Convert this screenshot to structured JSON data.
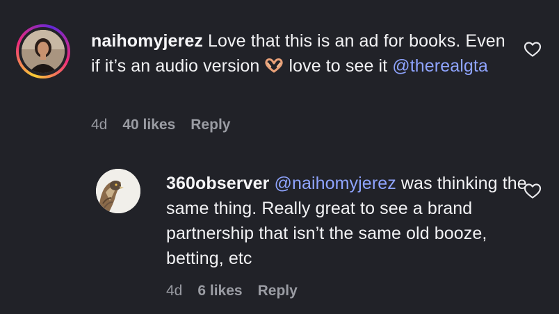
{
  "comments": [
    {
      "username": "naihomyjerez",
      "text_before_emoji": "Love that this is an ad for books. Even if it’s an audio version",
      "emoji_icon": "heart-hands-emoji",
      "text_after_emoji": "love to see it",
      "mention": "@therealgta",
      "time": "4d",
      "likes": "40 likes",
      "reply_label": "Reply",
      "like_icon": "heart-outline-icon"
    },
    {
      "username": "360observer",
      "mention": "@naihomyjerez",
      "text": "was thinking the same thing. Really great to see a brand partnership that isn’t the same old booze, betting, etc",
      "time": "4d",
      "likes": "6 likes",
      "reply_label": "Reply",
      "like_icon": "heart-outline-icon"
    }
  ],
  "colors": {
    "background": "#212228",
    "text": "#f2f2f4",
    "mention": "#8fa4ff",
    "meta": "#9a9ca3",
    "story_ring": [
      "#f9ce34",
      "#ee2a7b",
      "#6228d7"
    ]
  }
}
